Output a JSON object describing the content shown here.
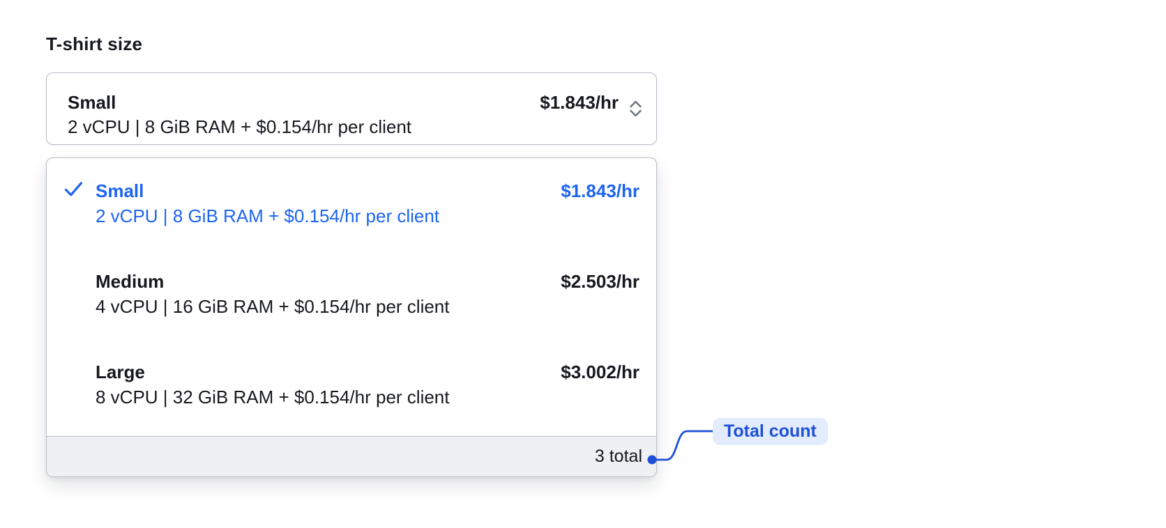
{
  "field": {
    "label": "T-shirt size"
  },
  "select": {
    "selected": {
      "name": "Small",
      "description": "2 vCPU | 8 GiB RAM + $0.154/hr per client",
      "price": "$1.843/hr"
    },
    "options": [
      {
        "name": "Small",
        "description": "2 vCPU | 8 GiB RAM + $0.154/hr per client",
        "price": "$1.843/hr",
        "selected": true
      },
      {
        "name": "Medium",
        "description": "4 vCPU | 16 GiB RAM + $0.154/hr per client",
        "price": "$2.503/hr",
        "selected": false
      },
      {
        "name": "Large",
        "description": "8 vCPU | 32 GiB RAM + $0.154/hr per client",
        "price": "$3.002/hr",
        "selected": false
      }
    ],
    "footer": {
      "total_label": "3 total"
    }
  },
  "annotation": {
    "label": "Total count"
  },
  "icons": {
    "trigger": "chevron-up-down-icon",
    "selected_option": "check-icon",
    "connector": "annotation-dot-connector"
  },
  "colors": {
    "accent": "#1c64f2",
    "annotation": "#1e4fd6",
    "annotation_bg": "#e2ecfd",
    "border": "#b6bdc7",
    "text": "#16181d",
    "icon_gray": "#6e7681",
    "footer_bg": "#eef0f2"
  }
}
